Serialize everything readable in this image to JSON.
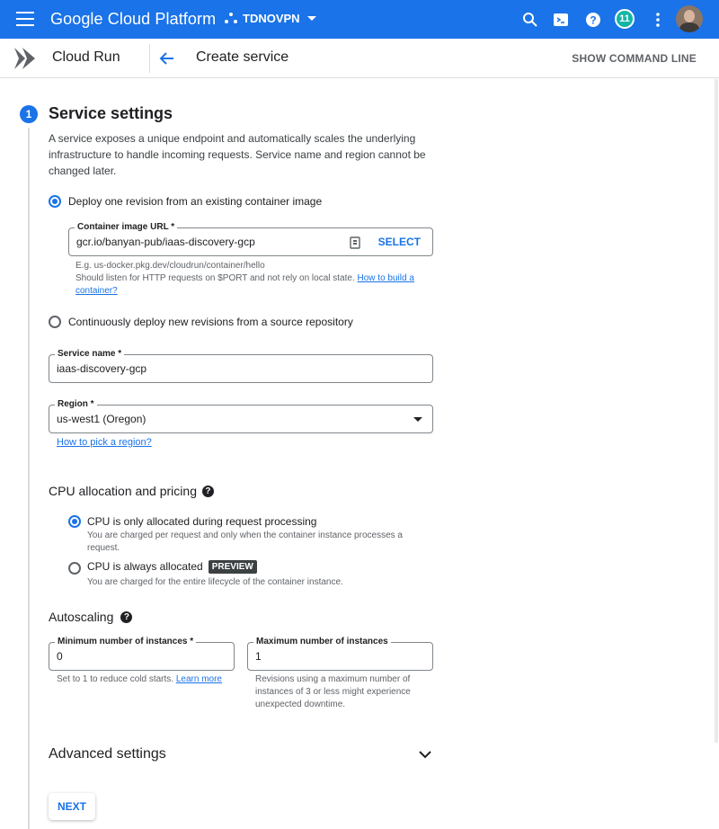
{
  "topbar": {
    "brand": "Google Cloud Platform",
    "project": "TDNOVPN",
    "notifications_count": "11"
  },
  "subbar": {
    "product": "Cloud Run",
    "page_title": "Create service",
    "command_line": "SHOW COMMAND LINE"
  },
  "step": {
    "number": "1",
    "title": "Service settings",
    "description": "A service exposes a unique endpoint and automatically scales the underlying infrastructure to handle incoming requests. Service name and region cannot be changed later."
  },
  "deploy": {
    "option1": "Deploy one revision from an existing container image",
    "option2": "Continuously deploy new revisions from a source repository",
    "selected": "option1",
    "image_label": "Container image URL *",
    "image_value": "gcr.io/banyan-pub/iaas-discovery-gcp",
    "select_label": "SELECT",
    "hint_example": "E.g. us-docker.pkg.dev/cloudrun/container/hello",
    "hint_listen": "Should listen for HTTP requests on $PORT and not rely on local state.",
    "hint_link": "How to build a container?"
  },
  "service_name": {
    "label": "Service name *",
    "value": "iaas-discovery-gcp"
  },
  "region": {
    "label": "Region *",
    "value": "us-west1 (Oregon)",
    "help_link": "How to pick a region?"
  },
  "cpu": {
    "title": "CPU allocation and pricing",
    "option1": "CPU is only allocated during request processing",
    "option1_hint": "You are charged per request and only when the container instance processes a request.",
    "option2": "CPU is always allocated",
    "option2_badge": "PREVIEW",
    "option2_hint": "You are charged for the entire lifecycle of the container instance.",
    "selected": "option1"
  },
  "autoscaling": {
    "title": "Autoscaling",
    "min_label": "Minimum number of instances *",
    "min_value": "0",
    "min_hint": "Set to 1 to reduce cold starts.",
    "min_link": "Learn more",
    "max_label": "Maximum number of instances",
    "max_value": "1",
    "max_hint": "Revisions using a maximum number of instances of 3 or less might experience unexpected downtime."
  },
  "advanced": {
    "title": "Advanced settings"
  },
  "actions": {
    "next": "NEXT"
  },
  "colors": {
    "primary": "#1a73e8",
    "badge": "#12b5a6"
  }
}
